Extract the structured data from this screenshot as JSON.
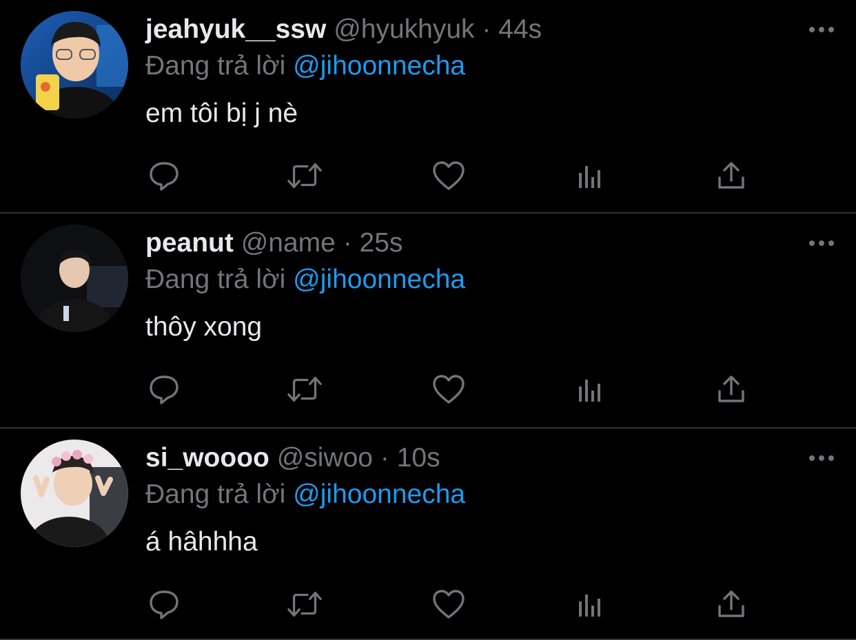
{
  "colors": {
    "background": "#000000",
    "text": "#e7e9ea",
    "muted": "#71767b",
    "accent": "#1d9bf0",
    "divider": "#2f3336"
  },
  "tweets": [
    {
      "display_name": "jeahyuk__ssw",
      "handle": "@hyukhyuk",
      "separator": "·",
      "time": "44s",
      "reply_prefix": "Đang trả lời",
      "reply_to": "@jihoonnecha",
      "text": "em tôi bị j nè",
      "avatar_icon": "user-photo-avatar"
    },
    {
      "display_name": "peanut",
      "handle": "@name",
      "separator": "·",
      "time": "25s",
      "reply_prefix": "Đang trả lời",
      "reply_to": "@jihoonnecha",
      "text": "thôy xong",
      "avatar_icon": "user-photo-avatar"
    },
    {
      "display_name": "si_woooo",
      "handle": "@siwoo",
      "separator": "·",
      "time": "10s",
      "reply_prefix": "Đang trả lời",
      "reply_to": "@jihoonnecha",
      "text": "á hâhhha",
      "avatar_icon": "user-photo-avatar"
    }
  ],
  "action_icons": [
    "reply-icon",
    "retweet-icon",
    "like-icon",
    "analytics-icon",
    "share-icon"
  ],
  "more_icon": "more-options-icon"
}
